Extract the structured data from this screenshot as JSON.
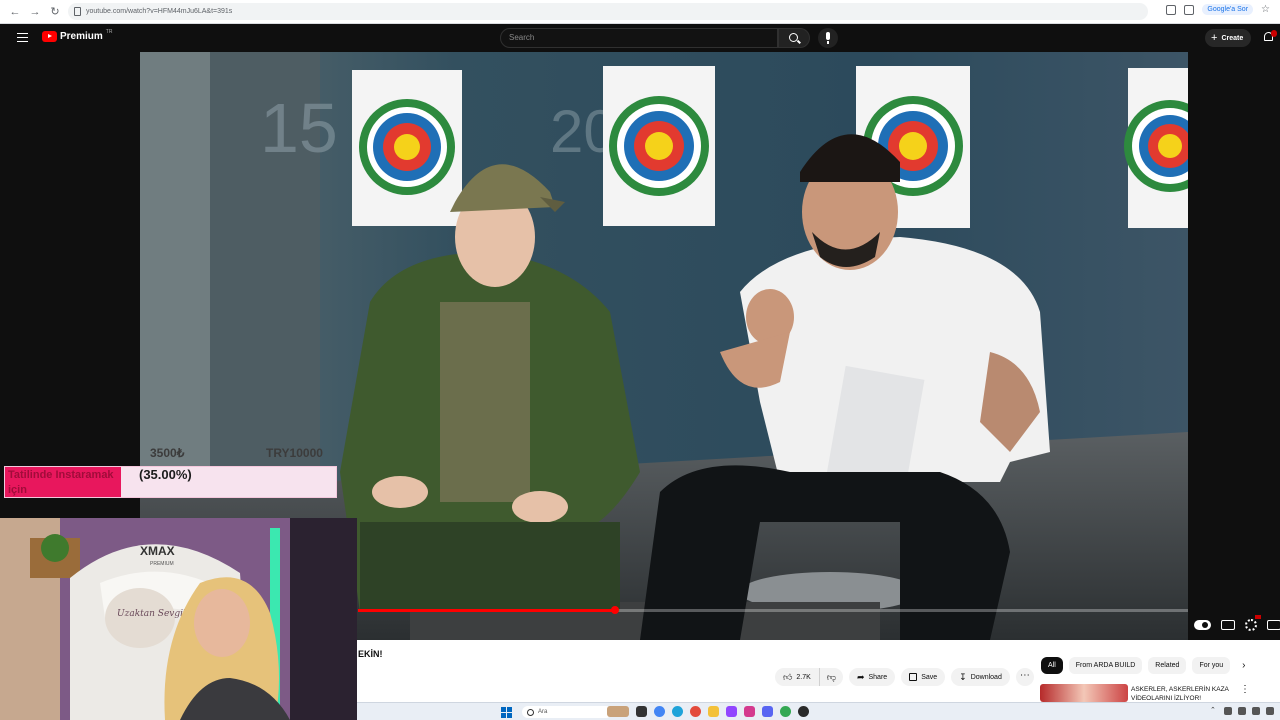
{
  "browser": {
    "url": "youtube.com/watch?v=HFM44mJu6LA&t=391s",
    "google_btn": "Google'a Sor"
  },
  "header": {
    "logo_text": "Premium",
    "logo_region": "TR",
    "search_placeholder": "Search",
    "create_label": "Create",
    "accent": "#ff0000"
  },
  "video": {
    "watch_progress": 0.31,
    "target_numbers": [
      "15",
      "20"
    ]
  },
  "donation": {
    "amount_current": "3500₺",
    "amount_goal": "TRY10000",
    "label": "Tatilinde Instaramak için",
    "percent_text": "(35.00%)",
    "progress": 0.35,
    "fill_color": "#e8175d"
  },
  "webcam": {
    "chair_brand": "XMAX",
    "chair_sub": "PREMIUM",
    "pillow_text": "Uzaktan Sevgili"
  },
  "below": {
    "title_fragment": "EKİN!",
    "likes": "2.7K",
    "share": "Share",
    "save": "Save",
    "download": "Download",
    "chips": [
      "All",
      "From ARDA BUILD",
      "Related",
      "For you"
    ],
    "rec_title": "ASKERLER, ASKERLERİN KAZA VİDEOLARINI İZLİYOR!"
  },
  "taskbar": {
    "search_text": "Ara"
  }
}
